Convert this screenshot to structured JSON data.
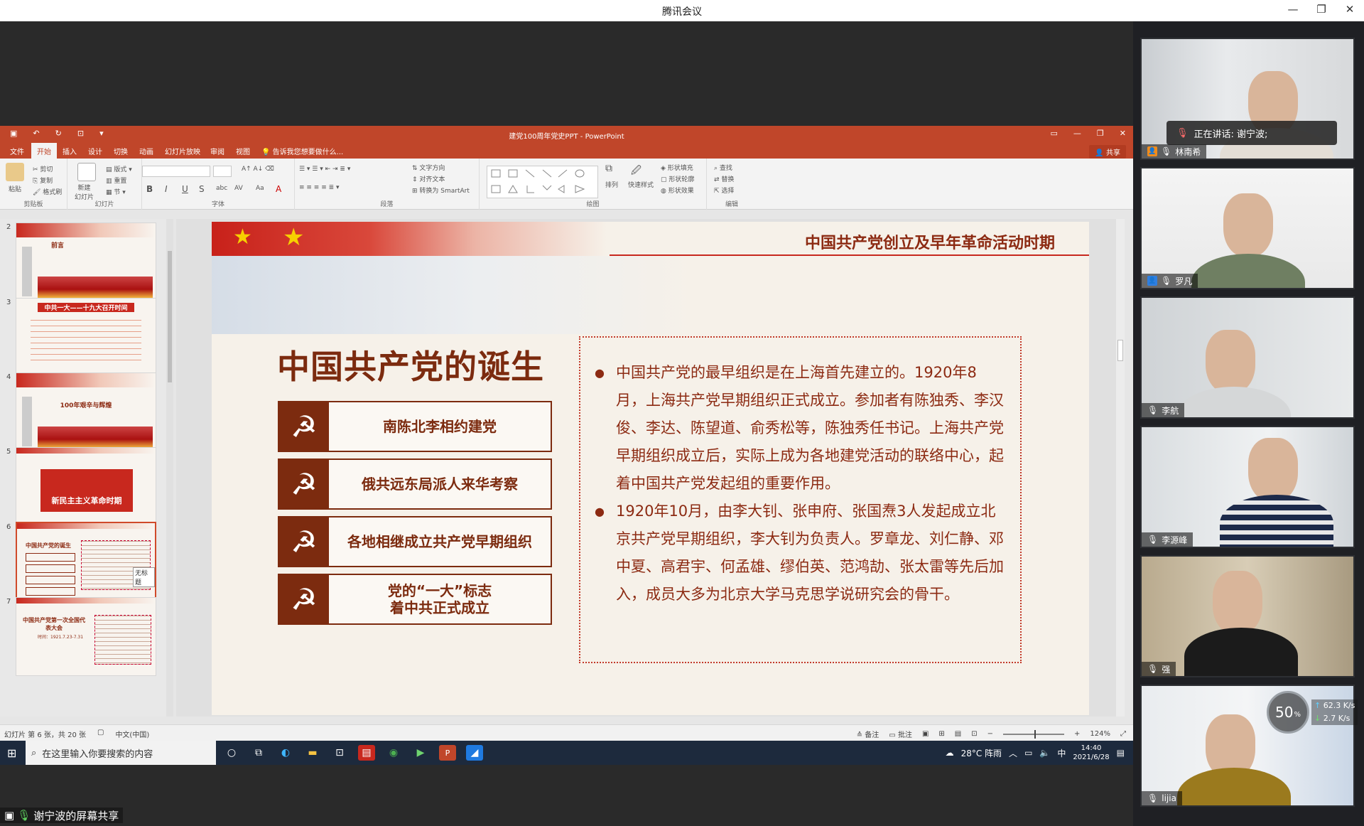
{
  "window": {
    "title": "腾讯会议"
  },
  "share": {
    "label": "谢宁波的屏幕共享"
  },
  "ppt": {
    "title": "建党100周年党史PPT - PowerPoint",
    "tabs": [
      "文件",
      "开始",
      "插入",
      "设计",
      "切换",
      "动画",
      "幻灯片放映",
      "审阅",
      "视图"
    ],
    "active_tab": "开始",
    "tell_me": "告诉我您想要做什么...",
    "share_button": "共享",
    "ribbon": {
      "clipboard": {
        "name": "剪贴板",
        "paste": "粘贴",
        "cut": "剪切",
        "copy": "复制",
        "format_painter": "格式刷"
      },
      "slides": {
        "name": "幻灯片",
        "new_slide": "新建\n幻灯片",
        "layout": "版式",
        "reset": "重置",
        "section": "节"
      },
      "font": {
        "name": "字体"
      },
      "paragraph": {
        "name": "段落",
        "text_direction": "文字方向",
        "align_text": "对齐文本",
        "convert_smartart": "转换为 SmartArt"
      },
      "drawing": {
        "name": "绘图",
        "arrange": "排列",
        "quick_styles": "快速样式",
        "shape_fill": "形状填充",
        "shape_outline": "形状轮廓",
        "shape_effects": "形状效果"
      },
      "editing": {
        "name": "编辑",
        "find": "查找",
        "replace": "替换",
        "select": "选择"
      }
    },
    "thumbnails": [
      {
        "num": "2",
        "caption": "前言"
      },
      {
        "num": "3",
        "caption": "中共一大——十九大召开时间"
      },
      {
        "num": "4",
        "caption": "100年艰辛与辉煌"
      },
      {
        "num": "5",
        "caption": "新民主主义革命时期"
      },
      {
        "num": "6",
        "caption": "中国共产党的诞生",
        "tooltip": "无标题"
      },
      {
        "num": "7",
        "caption": "中国共产党第一次全国代表大会",
        "sub": "时间：1921.7.23-7.31"
      }
    ],
    "slide": {
      "header": "中国共产党创立及早年革命活动时期",
      "title": "中国共产党的诞生",
      "buttons": [
        "南陈北李相约建党",
        "俄共远东局派人来华考察",
        "各地相继成立共产党早期组织",
        "党的“一大”标志\n着中共正式成立"
      ],
      "paragraphs": [
        "中国共产党的最早组织是在上海首先建立的。1920年8月，上海共产党早期组织正式成立。参加者有陈独秀、李汉俊、李达、陈望道、俞秀松等，陈独秀任书记。上海共产党早期组织成立后，实际上成为各地建党活动的联络中心，起着中国共产党发起组的重要作用。",
        "1920年10月，由李大钊、张申府、张国焘3人发起成立北京共产党早期组织，李大钊为负责人。罗章龙、刘仁静、邓中夏、高君宇、何孟雄、缪伯英、范鸿劼、张太雷等先后加入，成员大多为北京大学马克思学说研究会的骨干。"
      ]
    },
    "status": {
      "slide_info": "幻灯片 第 6 张，共 20 张",
      "language": "中文(中国)",
      "notes": "备注",
      "comments": "批注",
      "zoom": "124%"
    }
  },
  "taskbar": {
    "search_placeholder": "在这里输入你要搜索的内容",
    "weather": "28°C 阵雨",
    "ime": "中",
    "time": "14:40",
    "date": "2021/6/28"
  },
  "participants": [
    {
      "name": "林南希"
    },
    {
      "name": "罗凡"
    },
    {
      "name": "李航"
    },
    {
      "name": "李源峰"
    },
    {
      "name": "强"
    },
    {
      "name": "lijia"
    }
  ],
  "speaking": "正在讲话: 谢宁波;",
  "network": {
    "quality": "50",
    "unit": "%",
    "up": "62.3",
    "down": "2.7",
    "rate_unit": "K/s"
  },
  "colors": {
    "ppt_red": "#c0462a",
    "slide_brown": "#7c2b0f"
  }
}
